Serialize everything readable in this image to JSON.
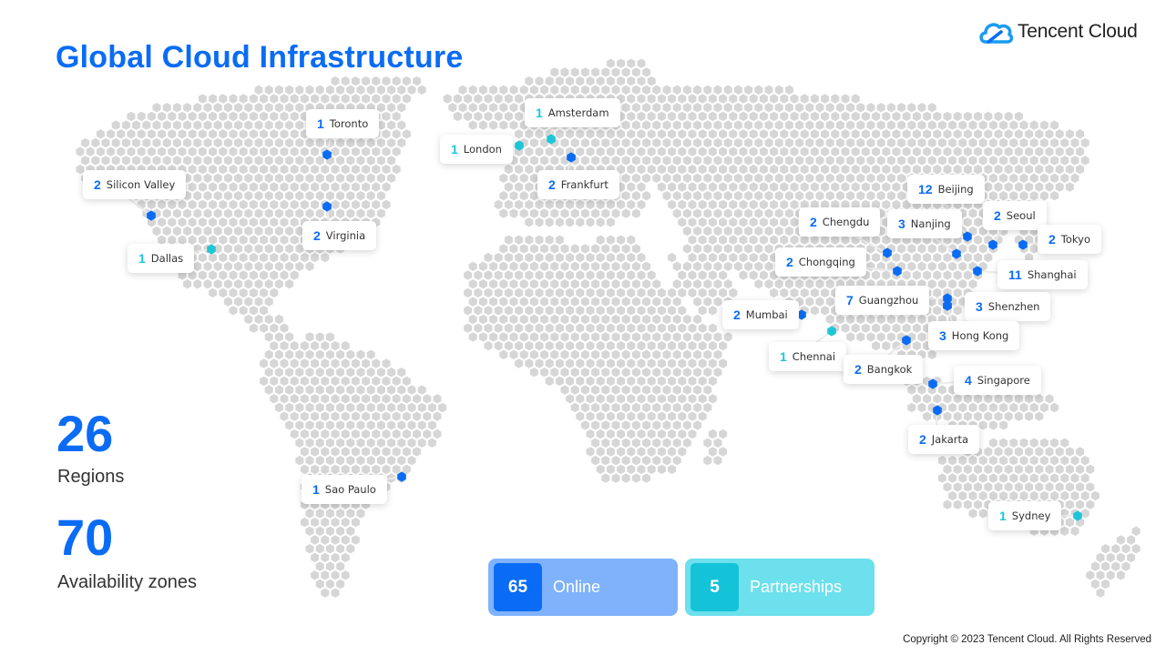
{
  "header": {
    "title": "Global Cloud Infrastructure",
    "logo_text": "Tencent Cloud",
    "logo_icon": "cloud-icon"
  },
  "colors": {
    "brand_blue": "#0a6cf5",
    "partner_cyan": "#1ec6d8",
    "map_dot": "#d6d6d6",
    "online_panel": "#7fb2fb",
    "online_badge": "#0a6cf5",
    "partner_panel": "#6ce0ec",
    "partner_badge": "#14c3d8"
  },
  "stats": [
    {
      "value": "26",
      "label": "Regions"
    },
    {
      "value": "70",
      "label": "Availability zones"
    }
  ],
  "summary": [
    {
      "value": "65",
      "label": "Online",
      "type": "online"
    },
    {
      "value": "5",
      "label": "Partnerships",
      "type": "partner"
    }
  ],
  "regions": [
    {
      "city": "Toronto",
      "zones": 1,
      "type": "online"
    },
    {
      "city": "Silicon Valley",
      "zones": 2,
      "type": "online"
    },
    {
      "city": "Virginia",
      "zones": 2,
      "type": "online"
    },
    {
      "city": "Dallas",
      "zones": 1,
      "type": "partner"
    },
    {
      "city": "Sao Paulo",
      "zones": 1,
      "type": "online"
    },
    {
      "city": "London",
      "zones": 1,
      "type": "partner"
    },
    {
      "city": "Amsterdam",
      "zones": 1,
      "type": "partner"
    },
    {
      "city": "Frankfurt",
      "zones": 2,
      "type": "online"
    },
    {
      "city": "Beijing",
      "zones": 12,
      "type": "online"
    },
    {
      "city": "Chengdu",
      "zones": 2,
      "type": "online"
    },
    {
      "city": "Nanjing",
      "zones": 3,
      "type": "online"
    },
    {
      "city": "Seoul",
      "zones": 2,
      "type": "online"
    },
    {
      "city": "Tokyo",
      "zones": 2,
      "type": "online"
    },
    {
      "city": "Chongqing",
      "zones": 2,
      "type": "online"
    },
    {
      "city": "Shanghai",
      "zones": 11,
      "type": "online"
    },
    {
      "city": "Guangzhou",
      "zones": 7,
      "type": "online"
    },
    {
      "city": "Shenzhen",
      "zones": 3,
      "type": "online"
    },
    {
      "city": "Mumbai",
      "zones": 2,
      "type": "online"
    },
    {
      "city": "Hong Kong",
      "zones": 3,
      "type": "online"
    },
    {
      "city": "Chennai",
      "zones": 1,
      "type": "partner"
    },
    {
      "city": "Bangkok",
      "zones": 2,
      "type": "online"
    },
    {
      "city": "Singapore",
      "zones": 4,
      "type": "online"
    },
    {
      "city": "Jakarta",
      "zones": 2,
      "type": "online"
    },
    {
      "city": "Sydney",
      "zones": 1,
      "type": "partner"
    }
  ],
  "footer": {
    "copyright": "Copyright © 2023 Tencent Cloud. All Rights Reserved"
  }
}
